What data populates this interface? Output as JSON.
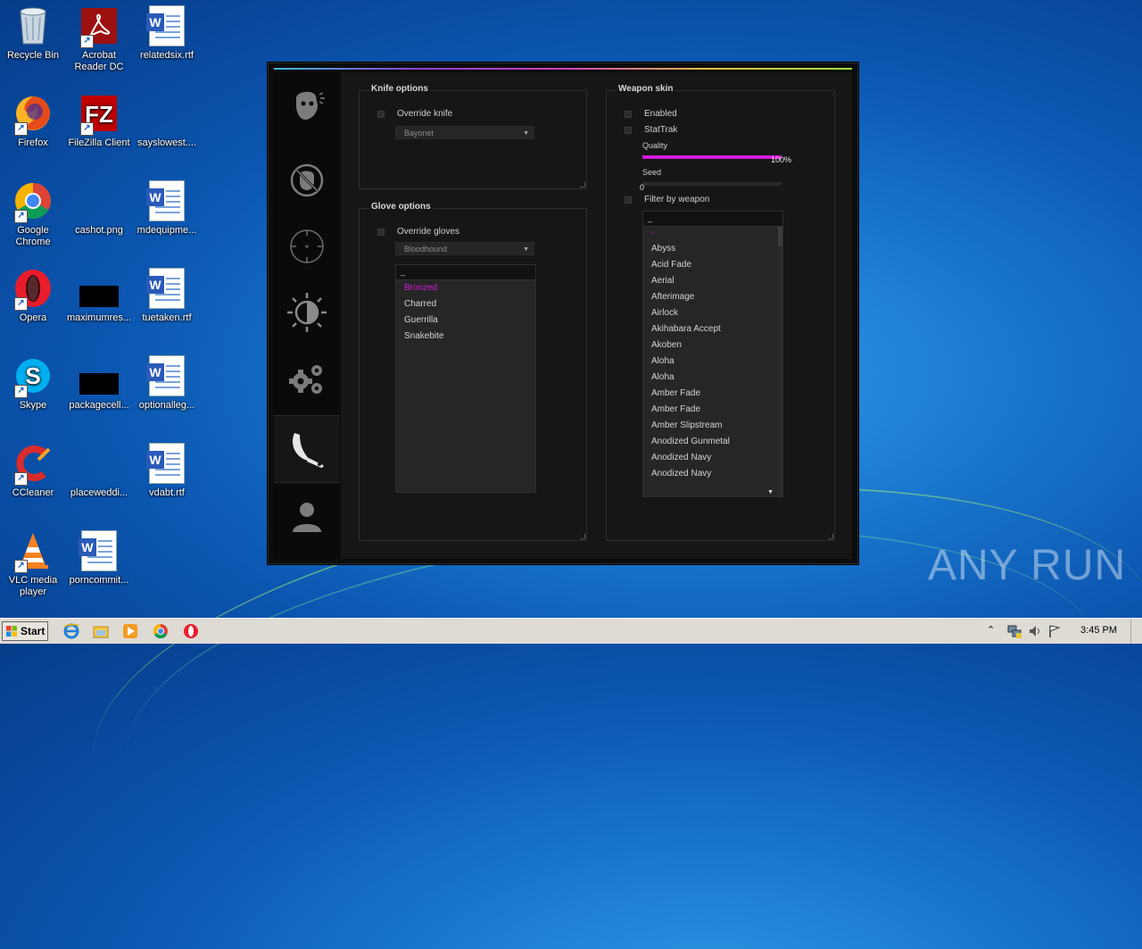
{
  "desktop": {
    "icons": [
      {
        "label": "Recycle Bin"
      },
      {
        "label": "Acrobat Reader DC"
      },
      {
        "label": "relatedsix.rtf"
      },
      {
        "label": "Firefox"
      },
      {
        "label": "FileZilla Client"
      },
      {
        "label": "sayslowest...."
      },
      {
        "label": "Google Chrome"
      },
      {
        "label": "cashot.png"
      },
      {
        "label": "mdequipme..."
      },
      {
        "label": "Opera"
      },
      {
        "label": "maximumres..."
      },
      {
        "label": "tuetaken.rtf"
      },
      {
        "label": "Skype"
      },
      {
        "label": "packagecell..."
      },
      {
        "label": "optionalleg..."
      },
      {
        "label": "CCleaner"
      },
      {
        "label": "placeweddi..."
      },
      {
        "label": "vdabt.rtf"
      },
      {
        "label": "VLC media player"
      },
      {
        "label": "porncommit..."
      }
    ]
  },
  "app": {
    "accent_color": "#d21ad8",
    "sidebar_tabs": [
      {
        "icon": "terrorist-head-icon"
      },
      {
        "icon": "no-visuals-icon"
      },
      {
        "icon": "crosshair-icon"
      },
      {
        "icon": "brightness-icon"
      },
      {
        "icon": "gears-icon"
      },
      {
        "icon": "karambit-knife-icon",
        "active": true
      },
      {
        "icon": "user-icon"
      }
    ],
    "knife": {
      "title": "Knife options",
      "override_label": "Override knife",
      "model_value": "Bayonet"
    },
    "glove": {
      "title": "Glove options",
      "override_label": "Override gloves",
      "model_value": "Bloodhound",
      "search_value": "_",
      "skins": [
        "Bronzed",
        "Charred",
        "Guerrilla",
        "Snakebite"
      ],
      "selected": "Bronzed"
    },
    "weapon": {
      "title": "Weapon skin",
      "enabled_label": "Enabled",
      "stattrak_label": "StatTrak",
      "quality_label": "Quality",
      "quality_value": 1.0,
      "quality_text": "100%",
      "seed_label": "Seed",
      "seed_value": "0",
      "filter_label": "Filter by weapon",
      "search_value": "_",
      "skins": [
        "-",
        "Abyss",
        "Acid Fade",
        "Aerial",
        "Afterimage",
        "Airlock",
        "Akihabara Accept",
        "Akoben",
        "Aloha",
        "Aloha",
        "Amber Fade",
        "Amber Fade",
        "Amber Slipstream",
        "Anodized Gunmetal",
        "Anodized Navy",
        "Anodized Navy"
      ],
      "selected": "-"
    }
  },
  "taskbar": {
    "start_label": "Start",
    "clock": "3:45 PM"
  },
  "watermark": "ANY RUN"
}
